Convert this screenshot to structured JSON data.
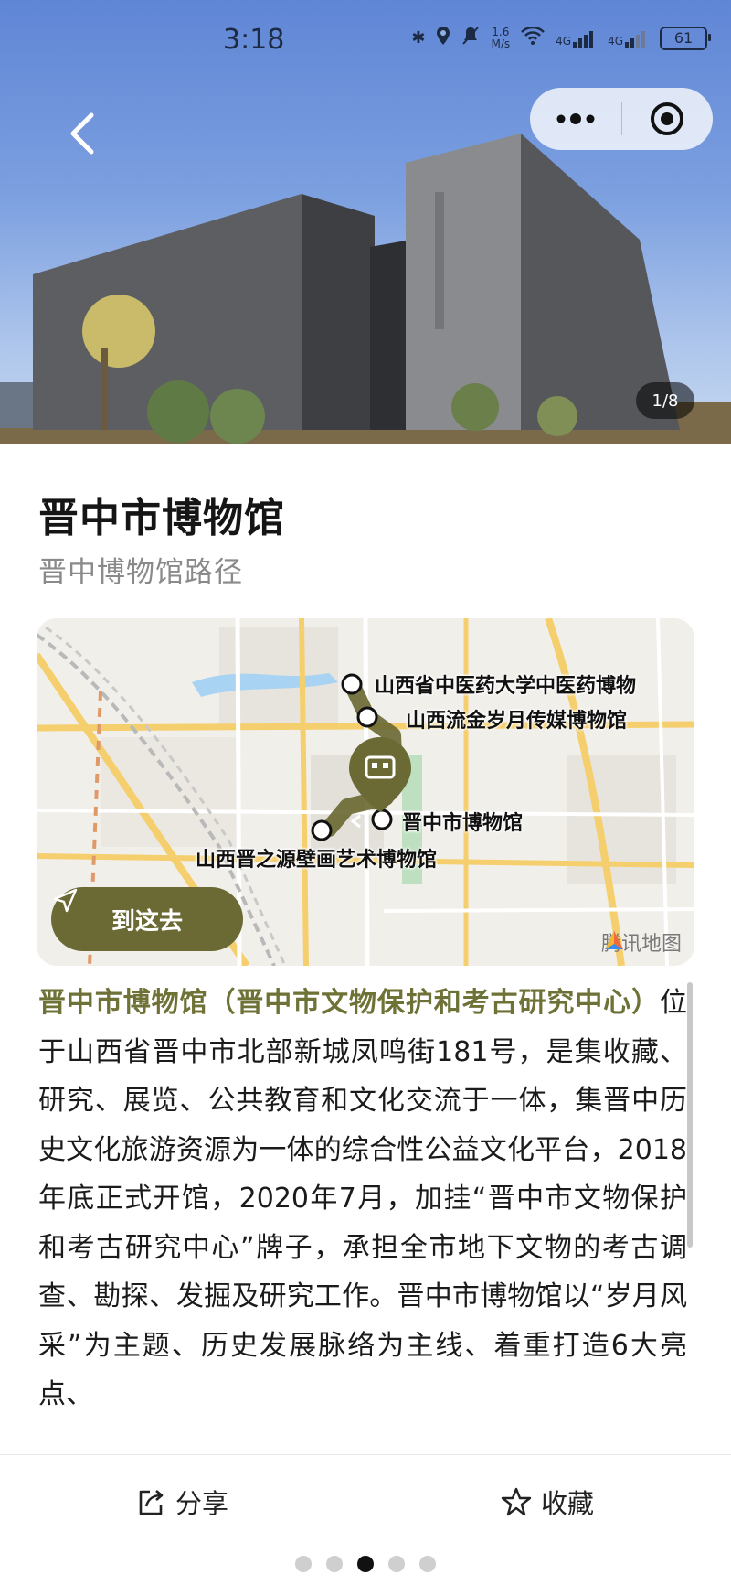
{
  "status_bar": {
    "time": "3:18",
    "net_speed_value": "1.6",
    "net_speed_unit": "M/s",
    "signal_1": "4G",
    "signal_2": "4G",
    "battery": "61"
  },
  "gallery": {
    "counter": "1/8"
  },
  "header": {
    "title": "晋中市博物馆",
    "subtitle": "晋中博物馆路径"
  },
  "map": {
    "labels": {
      "poi_1": "山西省中医药大学中医药博物",
      "poi_2": "山西流金岁月传媒博物馆",
      "current": "晋中市博物馆",
      "poi_3": "山西晋之源壁画艺术博物馆"
    },
    "navigate_label": "到这去",
    "provider": "腾讯地图"
  },
  "description": {
    "highlight": "晋中市博物馆（晋中市文物保护和考古研究中心）",
    "body": "位于山西省晋中市北部新城凤鸣街181号，是集收藏、研究、展览、公共教育和文化交流于一体，集晋中历史文化旅游资源为一体的综合性公益文化平台，2018年底正式开馆，2020年7月，加挂“晋中市文物保护和考古研究中心”牌子，承担全市地下文物的考古调查、勘探、发掘及研究工作。晋中市博物馆以“岁月风采”为主题、历史发展脉络为主线、着重打造6大亮点、"
  },
  "actions": {
    "share": "分享",
    "favorite": "收藏"
  },
  "colors": {
    "accent": "#6b6a34",
    "highlight_text": "#6f7236"
  }
}
